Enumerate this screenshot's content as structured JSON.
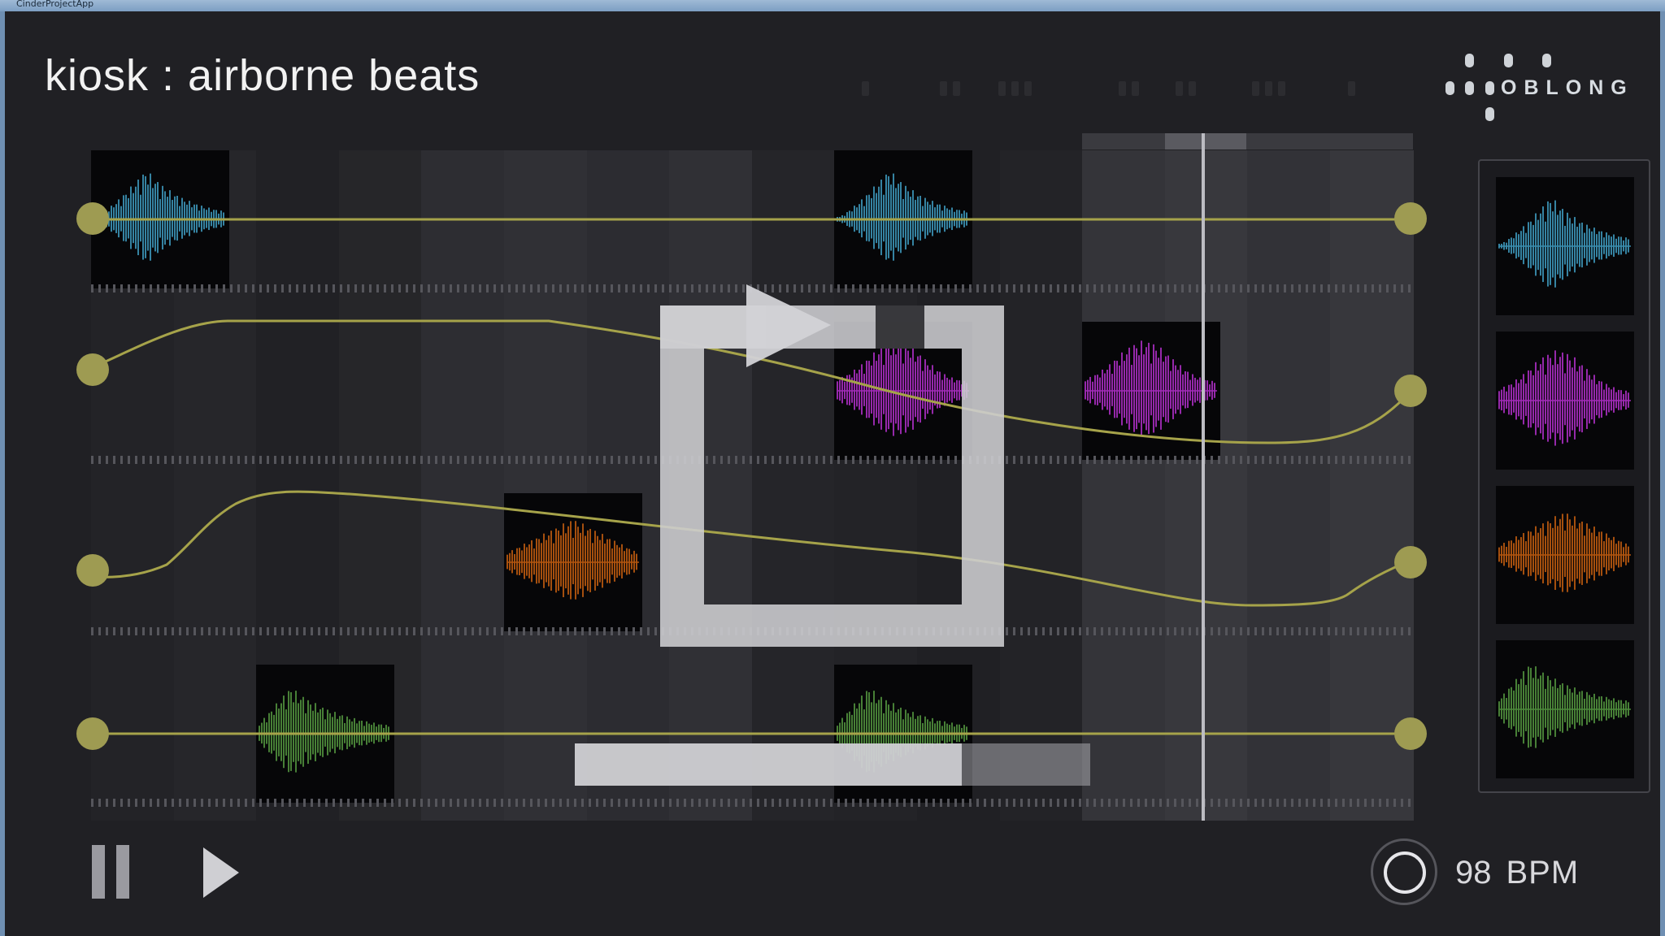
{
  "window": {
    "title": "CinderProjectApp"
  },
  "header": {
    "app_name": "kiosk",
    "separator": " : ",
    "song_title": "airborne beats"
  },
  "logo": {
    "wordmark": "OBLONG"
  },
  "transport": {
    "tempo_value": "98",
    "tempo_unit": "BPM",
    "pause_icon": "pause-icon",
    "play_icon": "play-icon",
    "loop_icon": "loop-icon",
    "tempo_dial_icon": "tempo-dial-icon"
  },
  "loop_progress": 0.75,
  "timeline_position": 0.7,
  "colors": {
    "background": "#1d1d21",
    "track_line": "#a6a34a",
    "handle": "#9e9b52",
    "blue_sample": "#3a8eb0",
    "purple_sample": "#a22bb8",
    "orange_sample": "#b3560f",
    "green_sample": "#4d8a3a"
  },
  "tracks": [
    {
      "name": "blue",
      "color": "#3a8eb0",
      "steps": [
        0,
        9
      ]
    },
    {
      "name": "purple",
      "color": "#a22bb8",
      "steps": [
        9,
        12
      ]
    },
    {
      "name": "orange",
      "color": "#b3560f",
      "steps": [
        5
      ]
    },
    {
      "name": "green",
      "color": "#4d8a3a",
      "steps": [
        2,
        9
      ]
    }
  ],
  "palette": [
    {
      "name": "blue",
      "color": "#3a8eb0"
    },
    {
      "name": "purple",
      "color": "#a22bb8"
    },
    {
      "name": "orange",
      "color": "#b3560f"
    },
    {
      "name": "green",
      "color": "#4d8a3a"
    }
  ]
}
